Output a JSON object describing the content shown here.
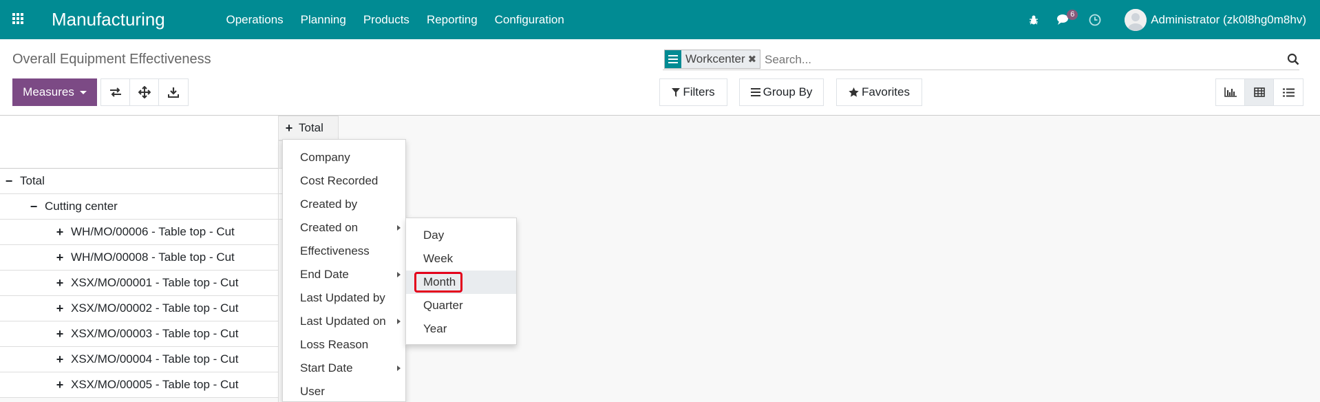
{
  "navbar": {
    "app_name": "Manufacturing",
    "menu": [
      "Operations",
      "Planning",
      "Products",
      "Reporting",
      "Configuration"
    ],
    "message_count": "6",
    "user_name": "Administrator (zk0l8hg0m8hv)",
    "color": "#018b93"
  },
  "control_panel": {
    "title": "Overall Equipment Effectiveness",
    "measures_label": "Measures",
    "measures_color": "#7c4a85",
    "search": {
      "facet_value": "Workcenter",
      "placeholder": "Search..."
    },
    "filters_label": "Filters",
    "groupby_label": "Group By",
    "favorites_label": "Favorites"
  },
  "pivot": {
    "col_total_label": "Total",
    "rows": [
      {
        "label": "Total",
        "level": 0,
        "expanded": true
      },
      {
        "label": "Cutting center",
        "level": 1,
        "expanded": true
      },
      {
        "label": "WH/MO/00006 - Table top - Cut",
        "level": 2,
        "expanded": false
      },
      {
        "label": "WH/MO/00008 - Table top - Cut",
        "level": 2,
        "expanded": false
      },
      {
        "label": "XSX/MO/00001 - Table top - Cut",
        "level": 2,
        "expanded": false
      },
      {
        "label": "XSX/MO/00002 - Table top - Cut",
        "level": 2,
        "expanded": false
      },
      {
        "label": "XSX/MO/00003 - Table top - Cut",
        "level": 2,
        "expanded": false
      },
      {
        "label": "XSX/MO/00004 - Table top - Cut",
        "level": 2,
        "expanded": false
      },
      {
        "label": "XSX/MO/00005 - Table top - Cut",
        "level": 2,
        "expanded": false
      }
    ]
  },
  "groupby_dropdown": {
    "items": [
      {
        "label": "Company",
        "submenu": false
      },
      {
        "label": "Cost Recorded",
        "submenu": false
      },
      {
        "label": "Created by",
        "submenu": false
      },
      {
        "label": "Created on",
        "submenu": true
      },
      {
        "label": "Effectiveness",
        "submenu": false
      },
      {
        "label": "End Date",
        "submenu": true
      },
      {
        "label": "Last Updated by",
        "submenu": false
      },
      {
        "label": "Last Updated on",
        "submenu": true
      },
      {
        "label": "Loss Reason",
        "submenu": false
      },
      {
        "label": "Start Date",
        "submenu": true
      },
      {
        "label": "User",
        "submenu": false
      }
    ]
  },
  "interval_submenu": {
    "items": [
      "Day",
      "Week",
      "Month",
      "Quarter",
      "Year"
    ],
    "highlighted": "Month"
  }
}
